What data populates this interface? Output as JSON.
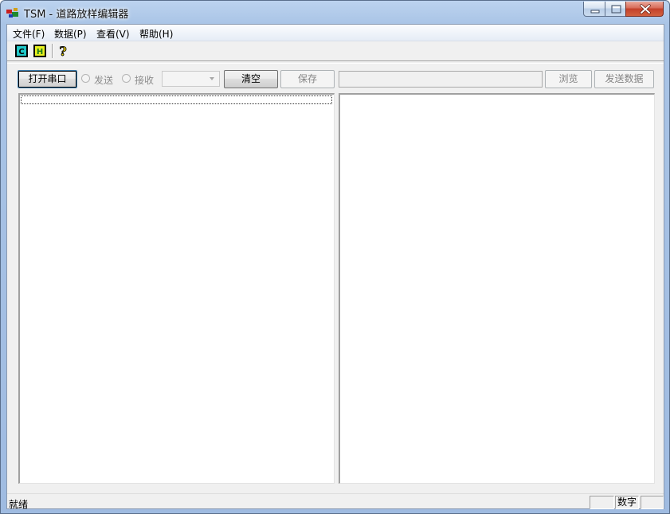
{
  "window": {
    "title": "TSM - 道路放样编辑器",
    "icon": "tsm-app-icon"
  },
  "menu": {
    "items": [
      "文件(F)",
      "数据(P)",
      "查看(V)",
      "帮助(H)"
    ]
  },
  "toolbar": {
    "buttons": [
      {
        "icon": "c-icon",
        "glyph": "C"
      },
      {
        "icon": "h-icon",
        "glyph": "H"
      },
      {
        "icon": "help-icon",
        "glyph": "?"
      }
    ]
  },
  "controls": {
    "open_port": "打开串口",
    "radio_send": "发送",
    "radio_receive": "接收",
    "combo_value": "",
    "clear": "清空",
    "save": "保存",
    "file_path": "",
    "browse": "浏览",
    "send_data": "发送数据"
  },
  "status": {
    "text": "就绪",
    "panels": [
      "",
      "数字",
      ""
    ]
  },
  "colors": {
    "title_bar": "#a9c4e6",
    "close_button": "#c3402a",
    "client_bg": "#f0f0f0"
  }
}
